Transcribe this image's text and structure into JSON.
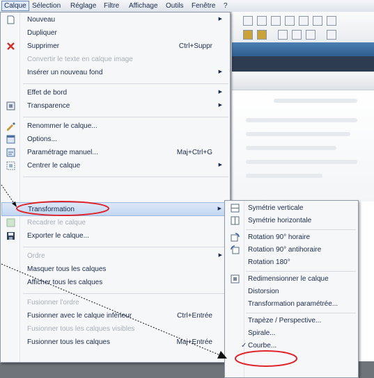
{
  "menubar": {
    "items": [
      "Calque",
      "Sélection",
      "Réglage",
      "Filtre",
      "Affichage",
      "Outils",
      "Fenêtre",
      "?"
    ]
  },
  "menu": {
    "items": [
      {
        "label": "Nouveau",
        "icon": "new-page-icon",
        "submenu": true
      },
      {
        "label": "Dupliquer"
      },
      {
        "label": "Supprimer",
        "icon": "delete-x-icon",
        "shortcut": "Ctrl+Suppr"
      },
      {
        "label": "Convertir le texte en calque image",
        "disabled": true
      },
      {
        "label": "Insérer un nouveau fond",
        "submenu": true
      },
      {
        "label": "Effet de bord",
        "submenu": true
      },
      {
        "label": "Transparence",
        "icon": "transparency-icon",
        "submenu": true
      },
      {
        "label": "Renommer le calque...",
        "icon": "rename-icon"
      },
      {
        "label": "Options...",
        "icon": "options-icon"
      },
      {
        "label": "Paramétrage manuel...",
        "icon": "manual-settings-icon",
        "shortcut": "Maj+Ctrl+G"
      },
      {
        "label": "Centrer le calque",
        "icon": "center-icon",
        "submenu": true
      },
      {
        "label": "Transformation",
        "submenu": true,
        "highlighted": true
      },
      {
        "label": "Recadrer le calque",
        "icon": "crop-icon",
        "disabled": true
      },
      {
        "label": "Exporter le calque...",
        "icon": "save-icon"
      },
      {
        "label": "Ordre",
        "disabled": true,
        "submenu": true
      },
      {
        "label": "Masquer tous les calques"
      },
      {
        "label": "Afficher tous les calques"
      },
      {
        "label": "Fusionner l'ordre",
        "disabled": true
      },
      {
        "label": "Fusionner avec le calque inférieur",
        "shortcut": "Ctrl+Entrée"
      },
      {
        "label": "Fusionner tous les calques visibles",
        "disabled": true
      },
      {
        "label": "Fusionner tous les calques",
        "shortcut": "Maj+Entrée"
      }
    ]
  },
  "submenu": {
    "items": [
      {
        "label": "Symétrie verticale",
        "icon": "flip-vertical-icon"
      },
      {
        "label": "Symétrie horizontale",
        "icon": "flip-horizontal-icon"
      },
      {
        "label": "Rotation 90° horaire",
        "icon": "rotate-cw-icon"
      },
      {
        "label": "Rotation 90° antihoraire",
        "icon": "rotate-ccw-icon"
      },
      {
        "label": "Rotation 180°"
      },
      {
        "label": "Redimensionner le calque",
        "icon": "resize-icon"
      },
      {
        "label": "Distorsion"
      },
      {
        "label": "Transformation paramétrée..."
      },
      {
        "label": "Trapèze / Perspective..."
      },
      {
        "label": "Spirale..."
      },
      {
        "label": "Courbe...",
        "checked": true
      }
    ]
  },
  "colors": {
    "annotation_red": "#e0242c",
    "highlight": "#c3d7f1",
    "menu_bg": "#f6f7f9"
  }
}
